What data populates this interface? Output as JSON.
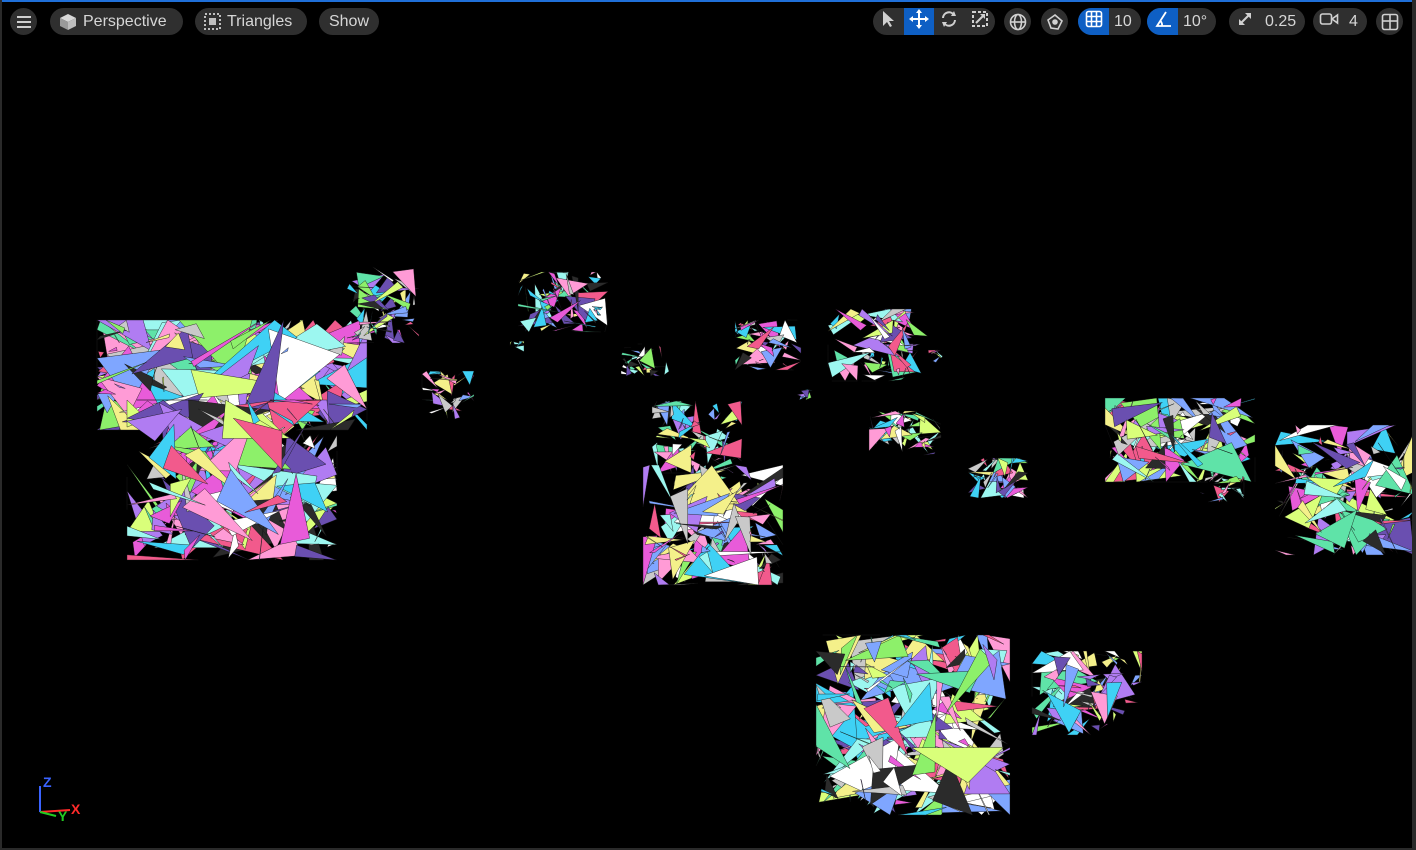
{
  "toolbar": {
    "menu_icon": "hamburger-icon",
    "view_mode": {
      "label": "Perspective",
      "icon": "cube-icon"
    },
    "view_show": {
      "label": "Triangles",
      "icon": "dotted-square-icon"
    },
    "show_menu": {
      "label": "Show"
    },
    "transform_tools": [
      "select-arrow-icon",
      "move-icon",
      "rotate-icon",
      "scale-icon"
    ],
    "active_tool": "move-icon",
    "world_local_icon": "globe-icon",
    "surface_snapping_icon": "surface-snap-icon",
    "grid_snap": {
      "icon": "grid-icon",
      "value": "10",
      "enabled": true
    },
    "rotation_snap": {
      "icon": "angle-icon",
      "value": "10°",
      "enabled": true
    },
    "scale_snap": {
      "icon": "scale-arrow-icon",
      "value": "0.25"
    },
    "camera_speed": {
      "icon": "camera-icon",
      "value": "4"
    },
    "layout_icon": "viewport-layout-icon"
  },
  "axis_gizmo": {
    "z": "Z",
    "y": "Y",
    "x": "X"
  },
  "colors": {
    "accent": "#0e5fc4",
    "toolbar_bg": "#2f2f2f",
    "viewport_bg": "#000000"
  }
}
